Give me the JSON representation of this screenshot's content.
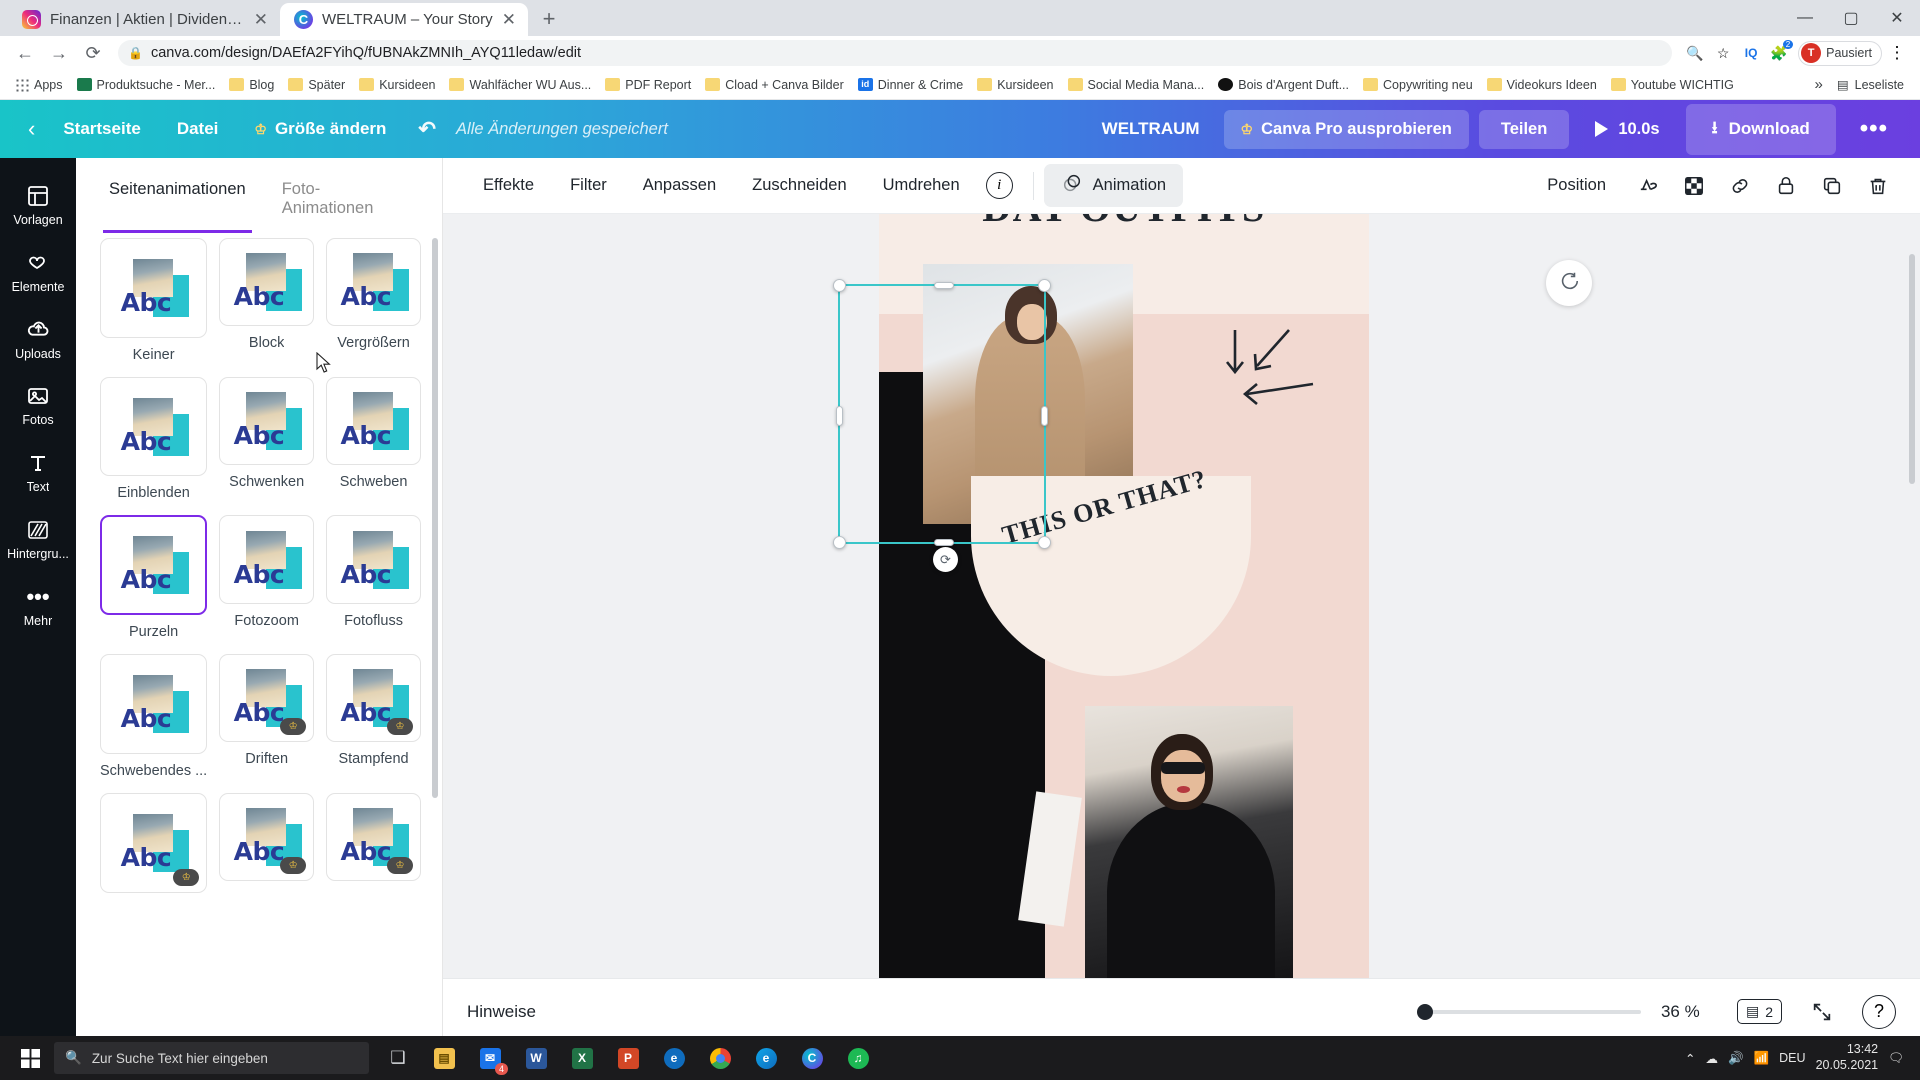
{
  "browser": {
    "tabs": [
      {
        "title": "Finanzen | Aktien | Dividende (@",
        "favicon": "instagram-icon",
        "active": false
      },
      {
        "title": "WELTRAUM – Your Story",
        "favicon": "canva-icon",
        "active": true
      }
    ],
    "new_tab_label": "+",
    "close_label": "✕",
    "nav": {
      "back": "←",
      "forward": "→",
      "reload": "⟳"
    },
    "url": "canva.com/design/DAEfA2FYihQ/fUBNAkZMNIh_AYQ11ledaw/edit",
    "lock_icon": "lock-icon",
    "omni_icons": [
      "zoom-icon",
      "star-icon"
    ],
    "extensions": [
      "iq-extension-icon",
      "puzzle-extension-icon"
    ],
    "extension_badge": "2",
    "profile": {
      "initial": "T",
      "label": "Pausiert"
    },
    "window_controls": {
      "minimize": "—",
      "maximize": "▢",
      "close": "✕"
    },
    "chrome_menu": "⋮",
    "bookmarks": [
      {
        "label": "Apps",
        "icon": "apps-grid-icon"
      },
      {
        "label": "Produktsuche - Mer...",
        "icon": "site-icon-green"
      },
      {
        "label": "Blog",
        "icon": "folder-icon"
      },
      {
        "label": "Später",
        "icon": "folder-icon"
      },
      {
        "label": "Kursideen",
        "icon": "folder-icon"
      },
      {
        "label": "Wahlfächer WU Aus...",
        "icon": "folder-icon"
      },
      {
        "label": "PDF Report",
        "icon": "folder-icon"
      },
      {
        "label": "Cload + Canva Bilder",
        "icon": "folder-icon"
      },
      {
        "label": "Dinner & Crime",
        "icon": "site-icon-blue"
      },
      {
        "label": "Kursideen",
        "icon": "folder-icon"
      },
      {
        "label": "Social Media Mana...",
        "icon": "folder-icon"
      },
      {
        "label": "Bois d'Argent Duft...",
        "icon": "site-icon-black"
      },
      {
        "label": "Copywriting neu",
        "icon": "folder-icon"
      },
      {
        "label": "Videokurs Ideen",
        "icon": "folder-icon"
      },
      {
        "label": "Youtube WICHTIG",
        "icon": "folder-icon"
      }
    ],
    "bookmarks_overflow": "»",
    "reading_list": "Leseliste"
  },
  "canva_header": {
    "back_icon": "chevron-left-icon",
    "home": "Startseite",
    "file": "Datei",
    "resize": "Größe ändern",
    "resize_icon": "crown-icon",
    "undo_icon": "undo-icon",
    "saved_status": "Alle Änderungen gespeichert",
    "doc_title": "WELTRAUM",
    "pro_button": "Canva Pro ausprobieren",
    "pro_icon": "crown-icon",
    "share_button": "Teilen",
    "play_icon": "play-icon",
    "duration": "10.0s",
    "download_button": "Download",
    "download_icon": "download-icon",
    "more_button": "•••"
  },
  "rail": {
    "items": [
      {
        "label": "Vorlagen",
        "icon": "templates-icon"
      },
      {
        "label": "Elemente",
        "icon": "shapes-icon"
      },
      {
        "label": "Uploads",
        "icon": "upload-cloud-icon"
      },
      {
        "label": "Fotos",
        "icon": "photo-icon"
      },
      {
        "label": "Text",
        "icon": "text-icon"
      },
      {
        "label": "Hintergru...",
        "icon": "background-icon"
      },
      {
        "label": "Mehr",
        "icon": "more-dots-icon"
      }
    ]
  },
  "panel": {
    "tabs": [
      {
        "label": "Seitenanimationen",
        "active": true
      },
      {
        "label": "Foto-Animationen",
        "active": false
      }
    ],
    "animations": [
      {
        "label": "Keiner",
        "pro": false,
        "selected": false
      },
      {
        "label": "Block",
        "pro": false,
        "selected": false
      },
      {
        "label": "Vergrößern",
        "pro": false,
        "selected": false
      },
      {
        "label": "Einblenden",
        "pro": false,
        "selected": false
      },
      {
        "label": "Schwenken",
        "pro": false,
        "selected": false
      },
      {
        "label": "Schweben",
        "pro": false,
        "selected": false
      },
      {
        "label": "Purzeln",
        "pro": false,
        "selected": true
      },
      {
        "label": "Fotozoom",
        "pro": false,
        "selected": false
      },
      {
        "label": "Fotofluss",
        "pro": false,
        "selected": false
      },
      {
        "label": "Schwebendes ...",
        "pro": false,
        "selected": false
      },
      {
        "label": "Driften",
        "pro": true,
        "selected": false
      },
      {
        "label": "Stampfend",
        "pro": true,
        "selected": false
      },
      {
        "label": "",
        "pro": true,
        "selected": false
      },
      {
        "label": "",
        "pro": true,
        "selected": false
      },
      {
        "label": "",
        "pro": true,
        "selected": false
      }
    ],
    "thumb_text": "Abc",
    "crown_glyph": "♔"
  },
  "editor_toolbar": {
    "tools": [
      "Effekte",
      "Filter",
      "Anpassen",
      "Zuschneiden",
      "Umdrehen"
    ],
    "info_icon": "info-icon",
    "animation_button": "Animation",
    "animation_icon": "animation-icon",
    "position_button": "Position",
    "right_icons": [
      "transparency-icon",
      "checker-icon",
      "link-icon",
      "lock-icon",
      "duplicate-icon",
      "delete-icon"
    ]
  },
  "canvas": {
    "page_title": "DAY OUTFITS",
    "sticker_text": "THIS OR THAT?",
    "comment_icon": "comment-icon",
    "rotate_icon": "rotate-icon",
    "selection": {
      "color": "#3ac6c9"
    }
  },
  "bottom_bar": {
    "notes_label": "Hinweise",
    "collapse_icon": "chevron-up-icon",
    "zoom_percent": "36 %",
    "page_count": "2",
    "page_count_icon": "pages-icon",
    "fullscreen_icon": "expand-icon",
    "help_icon": "help-icon"
  },
  "taskbar": {
    "start_icon": "windows-start-icon",
    "search_placeholder": "Zur Suche Text hier eingeben",
    "search_icon": "search-icon",
    "apps": [
      {
        "name": "task-view-icon",
        "glyph": "❑",
        "color": "#c9ccd1",
        "badge": ""
      },
      {
        "name": "file-explorer-icon",
        "glyph": "📁",
        "color": "#f2c14e",
        "badge": ""
      },
      {
        "name": "mail-icon",
        "glyph": "✉",
        "color": "#1a73e8",
        "badge": "4"
      },
      {
        "name": "word-icon",
        "glyph": "W",
        "color": "#2b579a",
        "badge": ""
      },
      {
        "name": "excel-icon",
        "glyph": "X",
        "color": "#217346",
        "badge": ""
      },
      {
        "name": "powerpoint-icon",
        "glyph": "P",
        "color": "#d24726",
        "badge": ""
      },
      {
        "name": "edge-legacy-icon",
        "glyph": "e",
        "color": "#0f6cbd",
        "badge": ""
      },
      {
        "name": "chrome-icon",
        "glyph": "◉",
        "color": "#4285f4",
        "badge": ""
      },
      {
        "name": "edge-icon",
        "glyph": "e",
        "color": "#0ea5e9",
        "badge": ""
      },
      {
        "name": "canva-icon",
        "glyph": "C",
        "color": "#00c4cc",
        "badge": ""
      },
      {
        "name": "spotify-icon",
        "glyph": "♫",
        "color": "#1db954",
        "badge": ""
      }
    ],
    "tray": {
      "overflow_icon": "chevron-up-icon",
      "onedrive_icon": "cloud-icon",
      "volume_icon": "speaker-icon",
      "network_icon": "wifi-icon",
      "language": "DEU",
      "time": "13:42",
      "date": "20.05.2021",
      "notifications_icon": "notification-icon"
    }
  }
}
